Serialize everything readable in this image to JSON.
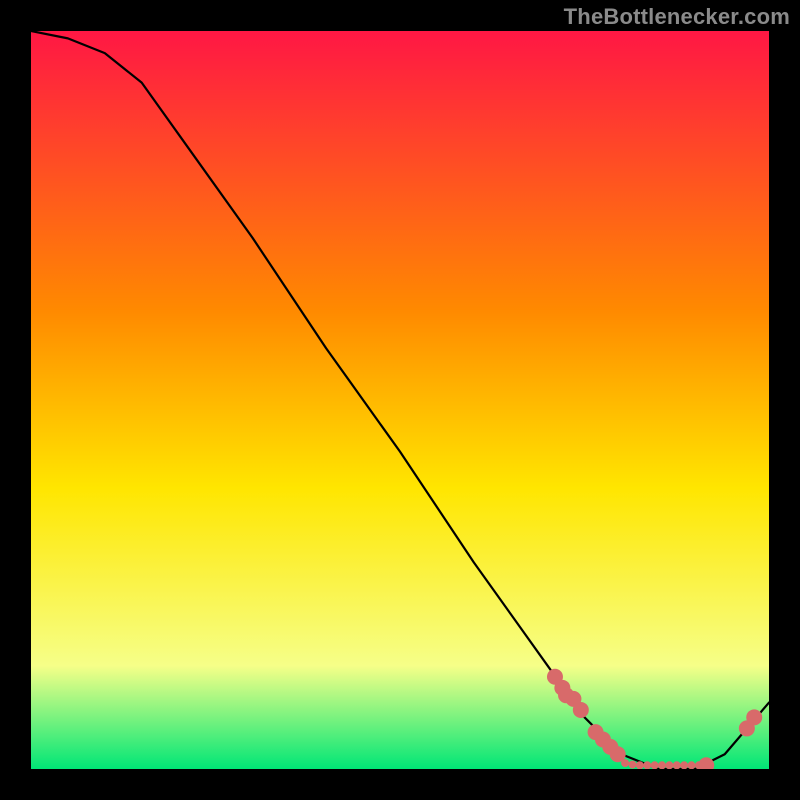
{
  "source_label": "TheBottlenecker.com",
  "colors": {
    "background": "#000000",
    "source_label": "#8a8a8a",
    "curve": "#000000",
    "marker": "#d86a6a",
    "gradient_top": "#ff1744",
    "gradient_mid_top": "#ff8a00",
    "gradient_mid": "#ffe600",
    "gradient_mid_bot": "#f6ff88",
    "gradient_bot": "#00e676"
  },
  "chart_data": {
    "type": "line",
    "title": "",
    "xlabel": "",
    "ylabel": "",
    "xlim": [
      0,
      100
    ],
    "ylim": [
      0,
      100
    ],
    "grid": false,
    "curve_points": [
      {
        "x": 0,
        "y": 100
      },
      {
        "x": 5,
        "y": 99
      },
      {
        "x": 10,
        "y": 97
      },
      {
        "x": 15,
        "y": 93
      },
      {
        "x": 20,
        "y": 86
      },
      {
        "x": 30,
        "y": 72
      },
      {
        "x": 40,
        "y": 57
      },
      {
        "x": 50,
        "y": 43
      },
      {
        "x": 60,
        "y": 28
      },
      {
        "x": 70,
        "y": 14
      },
      {
        "x": 75,
        "y": 7
      },
      {
        "x": 80,
        "y": 2
      },
      {
        "x": 85,
        "y": 0
      },
      {
        "x": 90,
        "y": 0
      },
      {
        "x": 94,
        "y": 2
      },
      {
        "x": 100,
        "y": 9
      }
    ],
    "markers": {
      "description": "Scatter points clustered near the curve minimum",
      "large": [
        {
          "x": 71,
          "y": 12.5
        },
        {
          "x": 72,
          "y": 11
        },
        {
          "x": 72.5,
          "y": 10
        },
        {
          "x": 73.5,
          "y": 9.5
        },
        {
          "x": 74.5,
          "y": 8
        },
        {
          "x": 76.5,
          "y": 5
        },
        {
          "x": 77.5,
          "y": 4
        },
        {
          "x": 78.5,
          "y": 3
        },
        {
          "x": 79.5,
          "y": 2
        },
        {
          "x": 91.5,
          "y": 0.5
        },
        {
          "x": 97,
          "y": 5.5
        },
        {
          "x": 98,
          "y": 7
        }
      ],
      "small": [
        {
          "x": 80.5,
          "y": 0.8
        },
        {
          "x": 81.5,
          "y": 0.6
        },
        {
          "x": 82.5,
          "y": 0.5
        },
        {
          "x": 83.5,
          "y": 0.5
        },
        {
          "x": 84.5,
          "y": 0.5
        },
        {
          "x": 85.5,
          "y": 0.5
        },
        {
          "x": 86.5,
          "y": 0.5
        },
        {
          "x": 87.5,
          "y": 0.5
        },
        {
          "x": 88.5,
          "y": 0.5
        },
        {
          "x": 89.5,
          "y": 0.5
        },
        {
          "x": 90.5,
          "y": 0.5
        }
      ]
    }
  }
}
